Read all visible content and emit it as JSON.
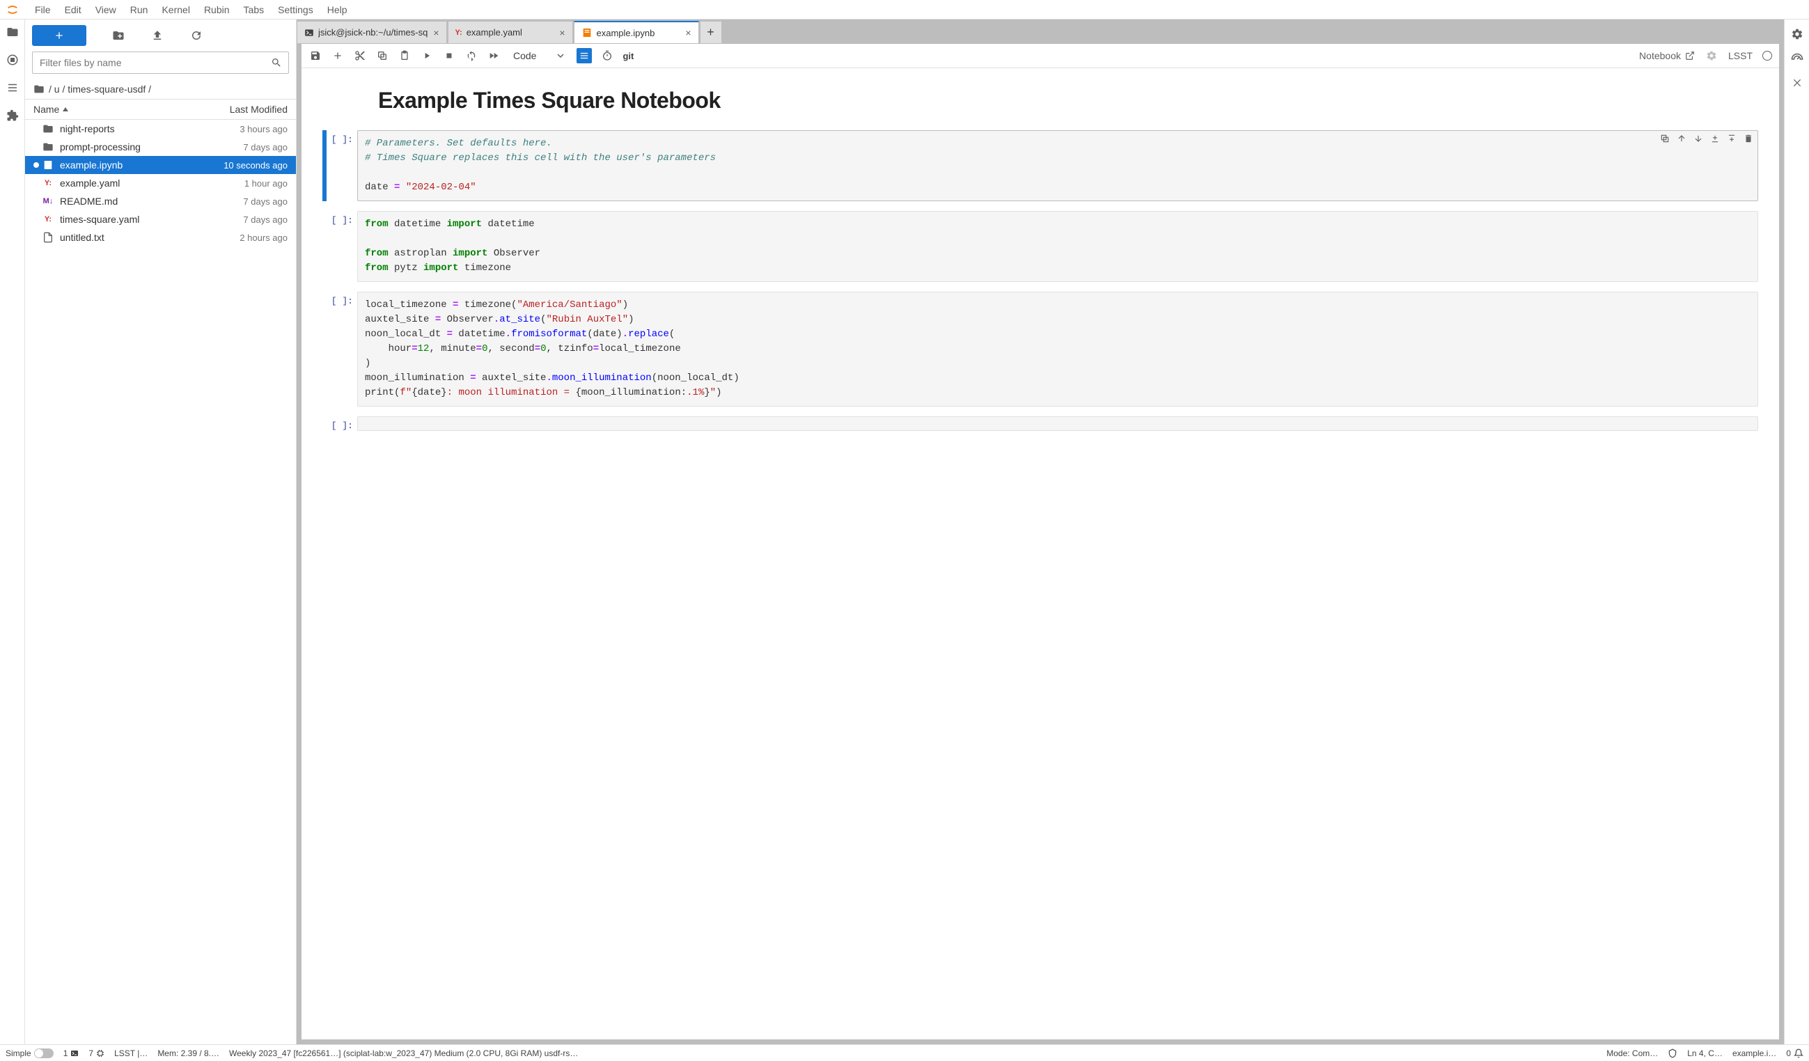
{
  "menu": [
    "File",
    "Edit",
    "View",
    "Run",
    "Kernel",
    "Rubin",
    "Tabs",
    "Settings",
    "Help"
  ],
  "filebrowser": {
    "filter_placeholder": "Filter files by name",
    "breadcrumb": "/ u / times-square-usdf /",
    "columns": {
      "name": "Name",
      "modified": "Last Modified"
    },
    "files": [
      {
        "icon": "folder",
        "name": "night-reports",
        "modified": "3 hours ago",
        "selected": false
      },
      {
        "icon": "folder",
        "name": "prompt-processing",
        "modified": "7 days ago",
        "selected": false
      },
      {
        "icon": "notebook",
        "name": "example.ipynb",
        "modified": "10 seconds ago",
        "selected": true
      },
      {
        "icon": "yaml",
        "name": "example.yaml",
        "modified": "1 hour ago",
        "selected": false
      },
      {
        "icon": "markdown",
        "name": "README.md",
        "modified": "7 days ago",
        "selected": false
      },
      {
        "icon": "yaml",
        "name": "times-square.yaml",
        "modified": "7 days ago",
        "selected": false
      },
      {
        "icon": "text",
        "name": "untitled.txt",
        "modified": "2 hours ago",
        "selected": false
      }
    ]
  },
  "tabs": [
    {
      "icon": "terminal",
      "label": "jsick@jsick-nb:~/u/times-sq",
      "active": false
    },
    {
      "icon": "yaml",
      "label": "example.yaml",
      "active": false
    },
    {
      "icon": "notebook",
      "label": "example.ipynb",
      "active": true
    }
  ],
  "notebook_toolbar": {
    "celltype": "Code",
    "git": "git",
    "notebook_label": "Notebook",
    "kernel": "LSST"
  },
  "notebook": {
    "title": "Example Times Square Notebook",
    "cells": [
      {
        "prompt": "[ ]:",
        "active": true,
        "html": "<span class='cm-comment'># Parameters. Set defaults here.</span>\n<span class='cm-comment'># Times Square replaces this cell with the user's parameters</span>\n\ndate <span class='cm-op'>=</span> <span class='cm-string'>\"2024-02-04\"</span>"
      },
      {
        "prompt": "[ ]:",
        "active": false,
        "html": "<span class='cm-keyword'>from</span> datetime <span class='cm-keyword'>import</span> datetime\n\n<span class='cm-keyword'>from</span> astroplan <span class='cm-keyword'>import</span> Observer\n<span class='cm-keyword'>from</span> pytz <span class='cm-keyword'>import</span> timezone"
      },
      {
        "prompt": "[ ]:",
        "active": false,
        "html": "local_timezone <span class='cm-op'>=</span> timezone(<span class='cm-string'>\"America/Santiago\"</span>)\nauxtel_site <span class='cm-op'>=</span> Observer<span class='cm-op'>.</span><span class='cm-func'>at_site</span>(<span class='cm-string'>\"Rubin AuxTel\"</span>)\nnoon_local_dt <span class='cm-op'>=</span> datetime<span class='cm-op'>.</span><span class='cm-func'>fromisoformat</span>(date)<span class='cm-op'>.</span><span class='cm-func'>replace</span>(\n    hour<span class='cm-op'>=</span><span class='cm-number'>12</span>, minute<span class='cm-op'>=</span><span class='cm-number'>0</span>, second<span class='cm-op'>=</span><span class='cm-number'>0</span>, tzinfo<span class='cm-op'>=</span>local_timezone\n)\nmoon_illumination <span class='cm-op'>=</span> auxtel_site<span class='cm-op'>.</span><span class='cm-func'>moon_illumination</span>(noon_local_dt)\nprint(<span class='cm-string'>f\"</span>{date}<span class='cm-string'>: moon illumination = </span>{moon_illumination:<span class='cm-string'>.1%</span>}<span class='cm-string'>\"</span>)"
      },
      {
        "prompt": "[ ]:",
        "active": false,
        "html": ""
      }
    ]
  },
  "statusbar": {
    "simple": "Simple",
    "terminals": "1",
    "kernels": "7",
    "lsst": "LSST |…",
    "mem": "Mem: 2.39 / 8.…",
    "weekly": "Weekly 2023_47 [fc226561…] (sciplat-lab:w_2023_47) Medium (2.0 CPU, 8Gi RAM) usdf-rs…",
    "mode": "Mode: Com…",
    "ln": "Ln 4, C…",
    "file": "example.i…",
    "notif": "0"
  }
}
